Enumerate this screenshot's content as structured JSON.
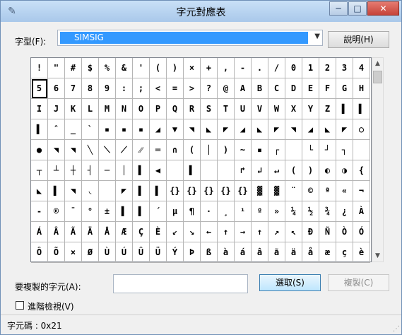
{
  "window": {
    "title": "字元對應表",
    "app_icon": "charmap-icon",
    "controls": {
      "minimize": "─",
      "maximize": "□",
      "close": "✕"
    }
  },
  "font": {
    "label": "字型(F):",
    "selected": "SIMSIG"
  },
  "help_button": "說明(H)",
  "grid": {
    "selected_index": 20,
    "rows": [
      [
        "!",
        "\"",
        "#",
        "$",
        "%",
        "&",
        "'",
        "(",
        ")",
        "×",
        "+",
        ",",
        "-",
        ".",
        "/",
        "0",
        "1",
        "2",
        "3",
        "4"
      ],
      [
        "5",
        "6",
        "7",
        "8",
        "9",
        ":",
        ";",
        "<",
        "=",
        ">",
        "?",
        "@",
        "A",
        "B",
        "C",
        "D",
        "E",
        "F",
        "G",
        "H"
      ],
      [
        "I",
        "J",
        "K",
        "L",
        "M",
        "N",
        "O",
        "P",
        "Q",
        "R",
        "S",
        "T",
        "U",
        "V",
        "W",
        "X",
        "Y",
        "Z",
        "▌",
        "▌"
      ],
      [
        "▌",
        "ˆ",
        "_",
        "`",
        "▪",
        "▪",
        "▪",
        "◢",
        "▼",
        "◥",
        "◣",
        "◤",
        "◢",
        "◣",
        "◤",
        "◥",
        "◢",
        "◣",
        "◤",
        "○"
      ],
      [
        "●",
        "◥",
        "◥",
        "╲",
        "⟍",
        "⟋",
        "⁄⁄",
        "═",
        "∩",
        "(",
        "│",
        ")",
        "~",
        "▪",
        "┌",
        "",
        "└",
        "┘",
        "┐",
        ""
      ],
      [
        "┬",
        "┴",
        "┼",
        "┤",
        "─",
        "│",
        "▌",
        "◀",
        "",
        "▌",
        "",
        "",
        "↱",
        "↲",
        "↵",
        "(",
        ")",
        "◐",
        "◑",
        "{"
      ],
      [
        "◣",
        "▌",
        "◥",
        "◟",
        "",
        "◤",
        "▌",
        "▌",
        "{}",
        "{}",
        "{}",
        "{}",
        "{}",
        "▓",
        "▓",
        "¨",
        "©",
        "ª",
        "«",
        "¬"
      ],
      [
        "-",
        "®",
        "¯",
        "°",
        "±",
        "▌",
        "▌",
        "´",
        "µ",
        "¶",
        "·",
        "¸",
        "¹",
        "º",
        "»",
        "¼",
        "½",
        "¾",
        "¿",
        "À"
      ],
      [
        "Á",
        "Â",
        "Ã",
        "Ä",
        "Å",
        "Æ",
        "Ç",
        "È",
        "↙",
        "↘",
        "←",
        "↑",
        "→",
        "↑",
        "↗",
        "↖",
        "Ð",
        "Ñ",
        "Ò",
        "Ó"
      ],
      [
        "Ô",
        "Õ",
        "×",
        "Ø",
        "Ù",
        "Ú",
        "Û",
        "Ü",
        "Ý",
        "Þ",
        "ß",
        "à",
        "á",
        "â",
        "ã",
        "ä",
        "å",
        "æ",
        "ç",
        "è"
      ]
    ]
  },
  "copy": {
    "label": "要複製的字元(A):",
    "value": "",
    "select_button": "選取(S)",
    "copy_button": "複製(C)"
  },
  "advanced": {
    "label": "進階檢視(V)",
    "checked": false
  },
  "status": {
    "text": "字元碼 : 0x21"
  }
}
